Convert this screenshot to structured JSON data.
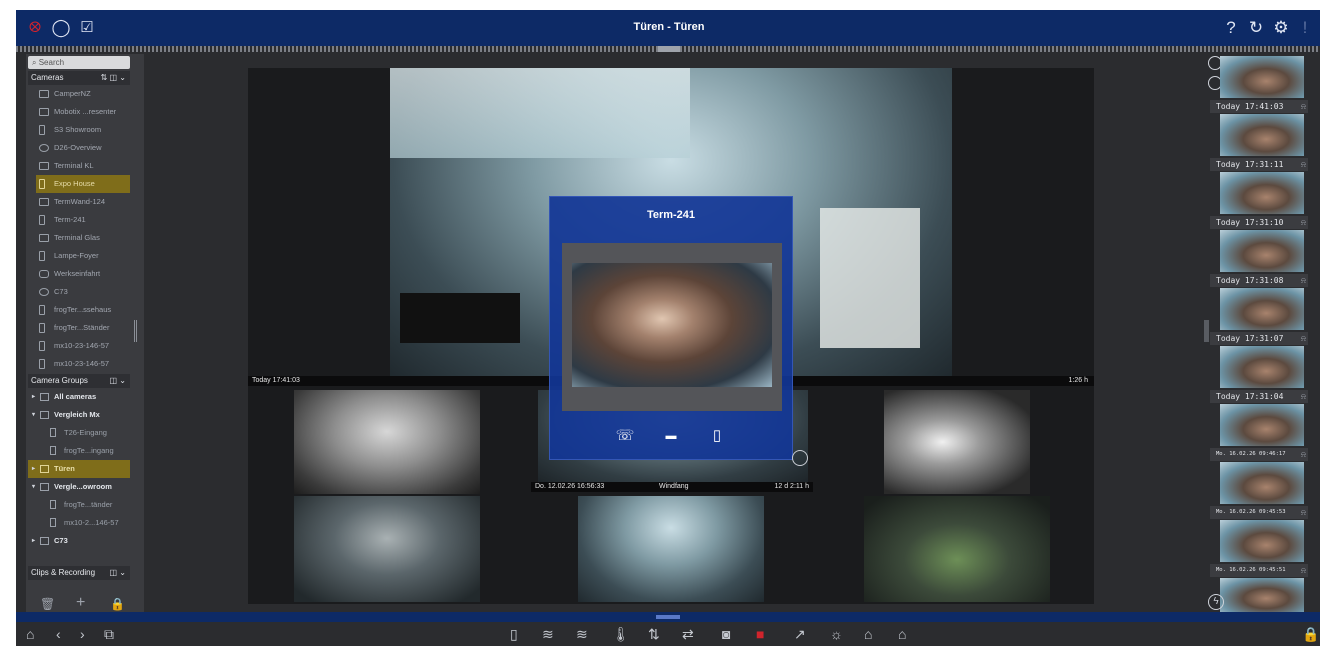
{
  "window": {
    "title": "Türen - Türen"
  },
  "topbar": {
    "left_icons": [
      "logo-icon",
      "chat-icon",
      "checklist-icon"
    ],
    "right_icons": [
      "help-icon",
      "reload-icon",
      "settings-icon",
      "alarm-icon"
    ],
    "help_glyph": "?",
    "reload_glyph": "↻",
    "settings_glyph": "⚙",
    "alarm_glyph": "!"
  },
  "sidebar": {
    "search_placeholder": "Search",
    "cameras_header": "Cameras",
    "cameras_controls": "⇅ ◫ ⌄",
    "cameras": [
      "CamperNZ",
      "Mobotix ...resenter",
      "S3 Showroom",
      "D26-Overview",
      "Terminal KL",
      "Expo House",
      "TermWand-124",
      "Term-241",
      "Terminal Glas",
      "Lampe-Foyer",
      "Werkseinfahrt",
      "C73",
      "frogTer...ssehaus",
      "frogTer...Ständer",
      "mx10-23-146-57",
      "mx10-23-146-57"
    ],
    "selected_camera": "Expo House",
    "groups_header": "Camera Groups",
    "groups_controls": "◫ ⌄",
    "groups": [
      {
        "label": "All cameras",
        "level": 0,
        "arrow": "▸"
      },
      {
        "label": "Vergleich Mx",
        "level": 0,
        "arrow": "▾"
      },
      {
        "label": "T26-Eingang",
        "level": 1,
        "arrow": ""
      },
      {
        "label": "frogTe...ingang",
        "level": 1,
        "arrow": ""
      },
      {
        "label": "Türen",
        "level": 0,
        "arrow": "▸",
        "selected": true
      },
      {
        "label": "Vergle...owroom",
        "level": 0,
        "arrow": "▾"
      },
      {
        "label": "frogTe...tänder",
        "level": 1,
        "arrow": ""
      },
      {
        "label": "mx10-2...146-57",
        "level": 1,
        "arrow": ""
      },
      {
        "label": "C73",
        "level": 0,
        "arrow": "▸"
      }
    ],
    "clips_header": "Clips & Recording",
    "clips_controls": "◫ ⌄",
    "bottom": {
      "delete": "🗑",
      "add": "+",
      "lock": "🔒"
    }
  },
  "main": {
    "top_tile": {
      "time": "Today 17:41:03",
      "duration": "1:26 h"
    },
    "center_tile": {
      "date": "Do. 12.02.26 16:56:33",
      "name": "Windfang",
      "duration": "12 d 2:11 h"
    }
  },
  "popup": {
    "title": "Term-241",
    "buttons": [
      "phone-icon",
      "unlock-icon",
      "door-icon"
    ],
    "phone_glyph": "☏",
    "unlock_glyph": "▬",
    "door_glyph": "▯"
  },
  "right_strip": {
    "timestamps": [
      "Today 17:41:03",
      "Today 17:31:11",
      "Today 17:31:10",
      "Today 17:31:08",
      "Today 17:31:07",
      "Today 17:31:04",
      "Mo. 16.02.26 09:46:17",
      "Mo. 16.02.26 09:45:53",
      "Mo. 16.02.26 09:45:51"
    ]
  },
  "bottombar": {
    "left_icons": [
      "home-icon",
      "back-icon",
      "forward-icon",
      "layout-icon"
    ],
    "center_icons": [
      "door-icon",
      "sensor-icon",
      "sensor2-icon",
      "thermometer-icon",
      "io-icon",
      "transfer-icon",
      "snapshot-icon",
      "record-icon",
      "export-icon",
      "light-icon",
      "lock-icon",
      "lock2-icon"
    ],
    "right_icons": [
      "padlock-icon"
    ],
    "home_glyph": "⌂",
    "back_glyph": "‹",
    "forward_glyph": "›",
    "layout_glyph": "⧉"
  }
}
